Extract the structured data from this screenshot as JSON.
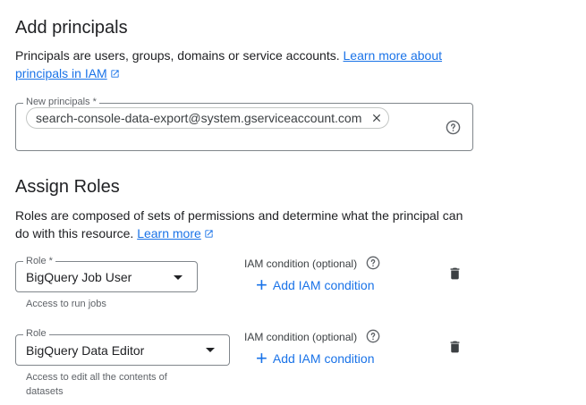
{
  "principals": {
    "heading": "Add principals",
    "description": "Principals are users, groups, domains or service accounts.",
    "learn_more_line1": "Learn more about",
    "learn_more_line2": "principals in IAM",
    "field_label": "New principals *",
    "chip_value": "search-console-data-export@system.gserviceaccount.com"
  },
  "roles": {
    "heading": "Assign Roles",
    "description_line1": "Roles are composed of sets of permissions and determine what the principal can",
    "description_line2": "do with this resource.",
    "learn_more": "Learn more",
    "items": [
      {
        "label": "Role *",
        "value": "BigQuery Job User",
        "helper_line1": "Access to run jobs",
        "helper_line2": "",
        "condition_label": "IAM condition (optional)",
        "add_condition": "Add IAM condition"
      },
      {
        "label": "Role",
        "value": "BigQuery Data Editor",
        "helper_line1": "Access to edit all the contents of",
        "helper_line2": "datasets",
        "condition_label": "IAM condition (optional)",
        "add_condition": "Add IAM condition"
      }
    ]
  },
  "icons": {
    "external": "external-link-icon",
    "help": "help-circle-icon",
    "close": "close-icon",
    "dropdown": "arrow-drop-down-icon",
    "delete": "trash-icon",
    "add": "plus-icon"
  },
  "colors": {
    "link": "#1a73e8",
    "text": "#202124",
    "secondary": "#5f6368",
    "border": "#80868b"
  }
}
